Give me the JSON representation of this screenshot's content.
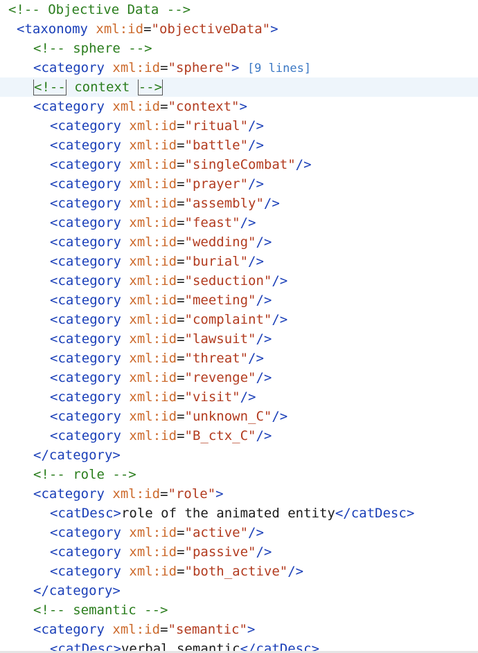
{
  "lines": [
    {
      "indent": 0,
      "kind": "comment",
      "text": "<!-- Objective Data -->"
    },
    {
      "indent": 1,
      "kind": "open",
      "tag": "taxonomy",
      "attr": "xml:id",
      "value": "\"objectiveData\"",
      "end": ">"
    },
    {
      "indent": 3,
      "kind": "comment",
      "text": "<!-- sphere -->"
    },
    {
      "indent": 3,
      "kind": "open",
      "tag": "category",
      "attr": "xml:id",
      "value": "\"sphere\"",
      "end": ">",
      "fold": "[9 lines]"
    },
    {
      "indent": 3,
      "kind": "comment-bracket",
      "pre": "<!--",
      "mid": " context ",
      "post": "-->",
      "current": true
    },
    {
      "indent": 3,
      "kind": "open",
      "tag": "category",
      "attr": "xml:id",
      "value": "\"context\"",
      "end": ">"
    },
    {
      "indent": 5,
      "kind": "open",
      "tag": "category",
      "attr": "xml:id",
      "value": "\"ritual\"",
      "end": "/>"
    },
    {
      "indent": 5,
      "kind": "open",
      "tag": "category",
      "attr": "xml:id",
      "value": "\"battle\"",
      "end": "/>"
    },
    {
      "indent": 5,
      "kind": "open",
      "tag": "category",
      "attr": "xml:id",
      "value": "\"singleCombat\"",
      "end": "/>"
    },
    {
      "indent": 5,
      "kind": "open",
      "tag": "category",
      "attr": "xml:id",
      "value": "\"prayer\"",
      "end": "/>"
    },
    {
      "indent": 5,
      "kind": "open",
      "tag": "category",
      "attr": "xml:id",
      "value": "\"assembly\"",
      "end": "/>"
    },
    {
      "indent": 5,
      "kind": "open",
      "tag": "category",
      "attr": "xml:id",
      "value": "\"feast\"",
      "end": "/>"
    },
    {
      "indent": 5,
      "kind": "open",
      "tag": "category",
      "attr": "xml:id",
      "value": "\"wedding\"",
      "end": "/>"
    },
    {
      "indent": 5,
      "kind": "open",
      "tag": "category",
      "attr": "xml:id",
      "value": "\"burial\"",
      "end": "/>"
    },
    {
      "indent": 5,
      "kind": "open",
      "tag": "category",
      "attr": "xml:id",
      "value": "\"seduction\"",
      "end": "/>"
    },
    {
      "indent": 5,
      "kind": "open",
      "tag": "category",
      "attr": "xml:id",
      "value": "\"meeting\"",
      "end": "/>"
    },
    {
      "indent": 5,
      "kind": "open",
      "tag": "category",
      "attr": "xml:id",
      "value": "\"complaint\"",
      "end": "/>"
    },
    {
      "indent": 5,
      "kind": "open",
      "tag": "category",
      "attr": "xml:id",
      "value": "\"lawsuit\"",
      "end": "/>"
    },
    {
      "indent": 5,
      "kind": "open",
      "tag": "category",
      "attr": "xml:id",
      "value": "\"threat\"",
      "end": "/>"
    },
    {
      "indent": 5,
      "kind": "open",
      "tag": "category",
      "attr": "xml:id",
      "value": "\"revenge\"",
      "end": "/>"
    },
    {
      "indent": 5,
      "kind": "open",
      "tag": "category",
      "attr": "xml:id",
      "value": "\"visit\"",
      "end": "/>"
    },
    {
      "indent": 5,
      "kind": "open",
      "tag": "category",
      "attr": "xml:id",
      "value": "\"unknown_C\"",
      "end": "/>"
    },
    {
      "indent": 5,
      "kind": "open",
      "tag": "category",
      "attr": "xml:id",
      "value": "\"B_ctx_C\"",
      "end": "/>"
    },
    {
      "indent": 3,
      "kind": "close",
      "tag": "category"
    },
    {
      "indent": 3,
      "kind": "comment",
      "text": "<!-- role -->"
    },
    {
      "indent": 3,
      "kind": "open",
      "tag": "category",
      "attr": "xml:id",
      "value": "\"role\"",
      "end": ">"
    },
    {
      "indent": 5,
      "kind": "element",
      "tag": "catDesc",
      "text": "role of the animated entity"
    },
    {
      "indent": 5,
      "kind": "open",
      "tag": "category",
      "attr": "xml:id",
      "value": "\"active\"",
      "end": "/>"
    },
    {
      "indent": 5,
      "kind": "open",
      "tag": "category",
      "attr": "xml:id",
      "value": "\"passive\"",
      "end": "/>"
    },
    {
      "indent": 5,
      "kind": "open",
      "tag": "category",
      "attr": "xml:id",
      "value": "\"both_active\"",
      "end": "/>"
    },
    {
      "indent": 3,
      "kind": "close",
      "tag": "category"
    },
    {
      "indent": 3,
      "kind": "comment",
      "text": "<!-- semantic -->"
    },
    {
      "indent": 3,
      "kind": "open",
      "tag": "category",
      "attr": "xml:id",
      "value": "\"semantic\"",
      "end": ">"
    },
    {
      "indent": 5,
      "kind": "element",
      "tag": "catDesc",
      "text": "verbal semantic"
    }
  ],
  "colors": {
    "comment": "#2a7d1d",
    "tag": "#1a3fb8",
    "attr": "#cc6a2c",
    "value": "#b23b1f",
    "text": "#1b1b1b",
    "fold": "#3b78c4",
    "current_line": "#eef5fb"
  }
}
